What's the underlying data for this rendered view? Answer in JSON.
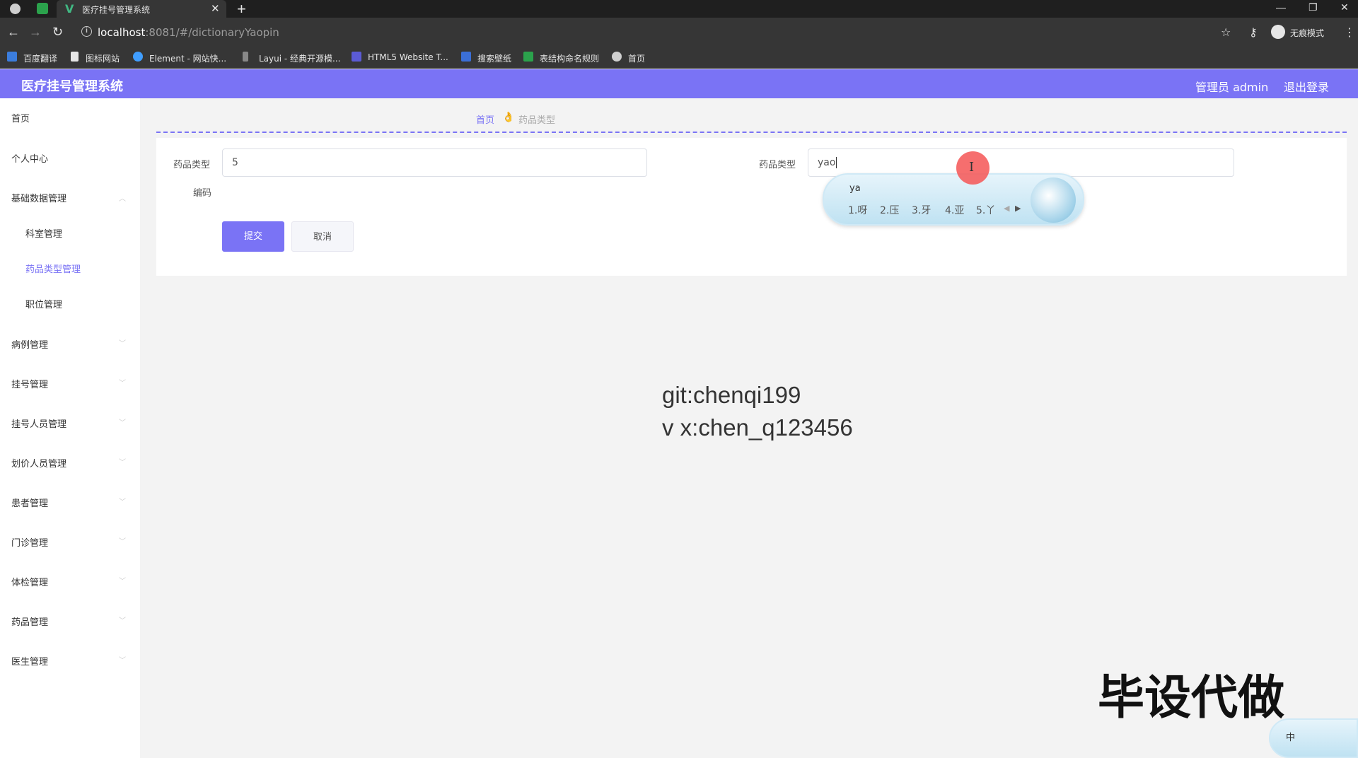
{
  "browser": {
    "tab_title": "医疗挂号管理系统",
    "url_host": "localhost",
    "url_path": ":8081/#/dictionaryYaopin",
    "incognito_label": "无痕模式",
    "bookmarks": [
      "百度翻译",
      "图标网站",
      "Element - 网站快...",
      "Layui - 经典开源模...",
      "HTML5 Website T...",
      "搜索壁纸",
      "表结构命名规则",
      "首页"
    ]
  },
  "header": {
    "title": "医疗挂号管理系统",
    "admin": "管理员 admin",
    "logout": "退出登录"
  },
  "sidebar": {
    "items": [
      "首页",
      "个人中心",
      "基础数据管理",
      "科室管理",
      "药品类型管理",
      "职位管理",
      "病例管理",
      "挂号管理",
      "挂号人员管理",
      "划价人员管理",
      "患者管理",
      "门诊管理",
      "体检管理",
      "药品管理",
      "医生管理"
    ],
    "active": "药品类型管理"
  },
  "breadcrumb": {
    "home": "首页",
    "current": "药品类型"
  },
  "form": {
    "field1_label_line1": "药品类型",
    "field1_label_line2": "编码",
    "field1_value": "5",
    "field2_label": "药品类型",
    "field2_value": "yao",
    "submit": "提交",
    "cancel": "取消"
  },
  "ime": {
    "input": "ya",
    "candidates": [
      "1.呀",
      "2.压",
      "3.牙",
      "4.亚",
      "5.丫"
    ],
    "status": "中"
  },
  "watermarks": {
    "line1": "git:chenqi199",
    "line2": "v x:chen_q123456",
    "big": "毕设代做"
  },
  "colors": {
    "accent": "#7a73f5",
    "cursor": "#f55a5a"
  }
}
